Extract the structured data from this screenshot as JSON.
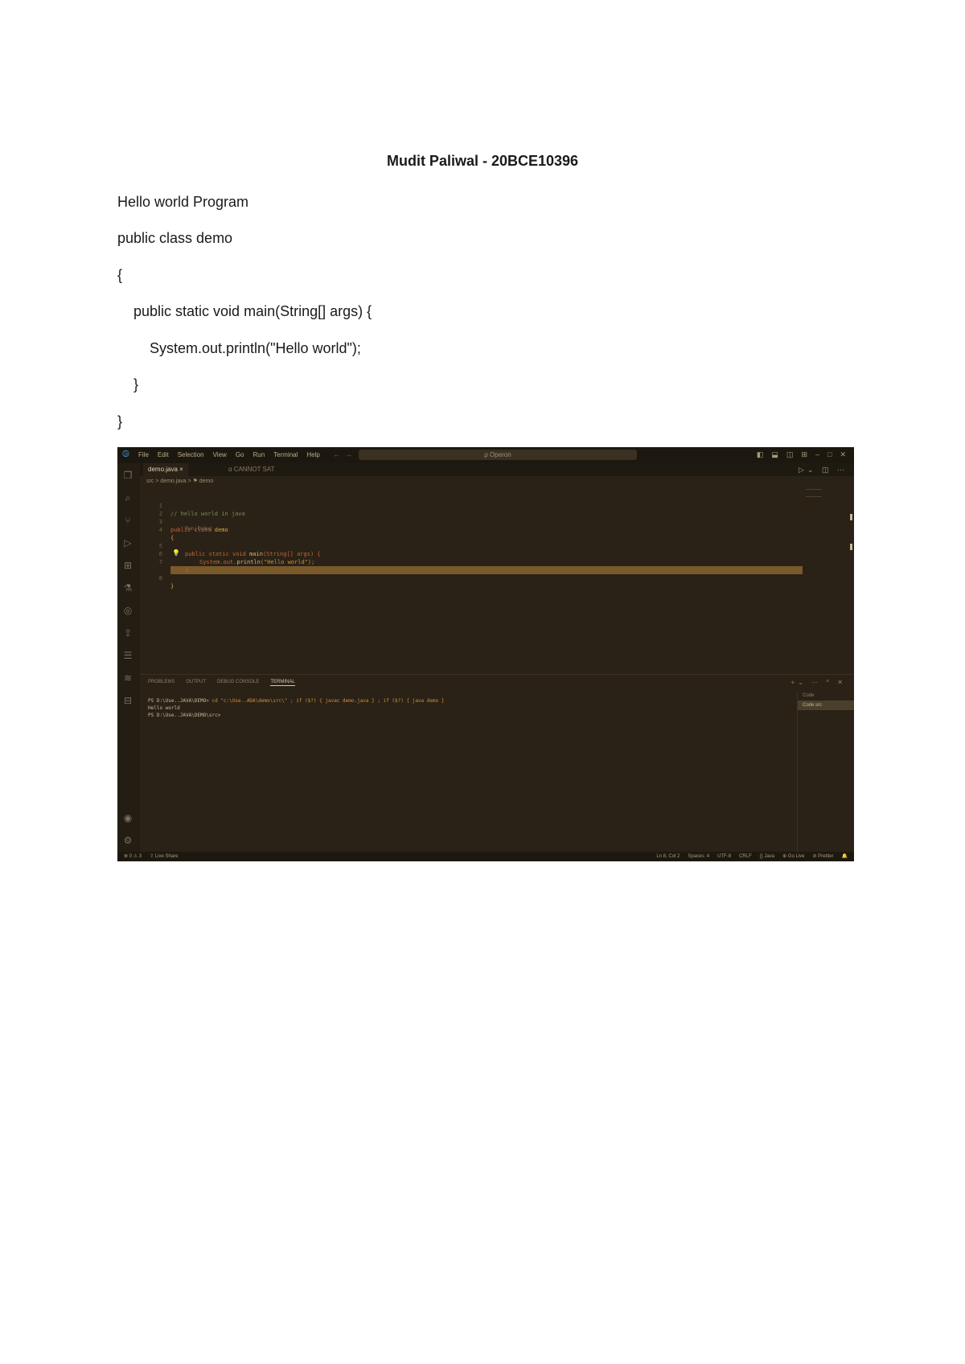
{
  "document": {
    "title": "Mudit Paliwal - 20BCE10396",
    "lines": [
      "Hello world Program",
      "public class demo",
      "{",
      "    public static void main(String[] args) {",
      "        System.out.println(\"Hello world\");",
      "    }",
      "}"
    ]
  },
  "vscode": {
    "menu": [
      "File",
      "Edit",
      "Selection",
      "View",
      "Go",
      "Run",
      "Terminal",
      "Help"
    ],
    "search_placeholder": "ρ Operon",
    "tabs": {
      "active": "demo.java ×",
      "inactive": "ɑ CANNOT SAT"
    },
    "breadcrumb": "src > demo.java > ⚑ demo",
    "code": {
      "line1": {
        "num": "1",
        "text": "// hello world in java"
      },
      "line2": {
        "num": "2"
      },
      "line3": {
        "num": "3",
        "kw": "public class ",
        "cls": "demo"
      },
      "line4": {
        "num": "4",
        "text": "{"
      },
      "lens": "Run | Debug",
      "line5": {
        "num": "5",
        "kw": "public static void ",
        "fn": "main",
        "rest": "(String[] args) {"
      },
      "line6": {
        "num": "6",
        "obj": "System.out.",
        "fn": "println",
        "str": "(\"Hello world\");"
      },
      "line7": {
        "num": "7",
        "text": "}"
      },
      "line8": {
        "num": "8",
        "text": "}"
      }
    },
    "panel_tabs": [
      "PROBLEMS",
      "OUTPUT",
      "DEBUG CONSOLE",
      "TERMINAL"
    ],
    "terminal": {
      "line1_prompt": "PS D:\\Use..JAVA\\DEMO>",
      "line1_cmd": " cd \"c:\\Use..ADA\\demo\\src\\\" ; if ($?) { javac demo.java } ; if ($?) { java demo }",
      "line2": "Hello world",
      "line3": "PS D:\\Use..JAVA\\DEMO\\src>"
    },
    "terminal_list": [
      "Code",
      "Code src"
    ],
    "status_left": [
      "⊗ 0 ⚠ 3",
      "⇪ Live Share"
    ],
    "status_right": [
      "Ln 8, Col 2",
      "Spaces: 4",
      "UTF-8",
      "CRLF",
      "{} Java",
      "⊕ Go Live",
      "⊘ Prettier"
    ]
  }
}
